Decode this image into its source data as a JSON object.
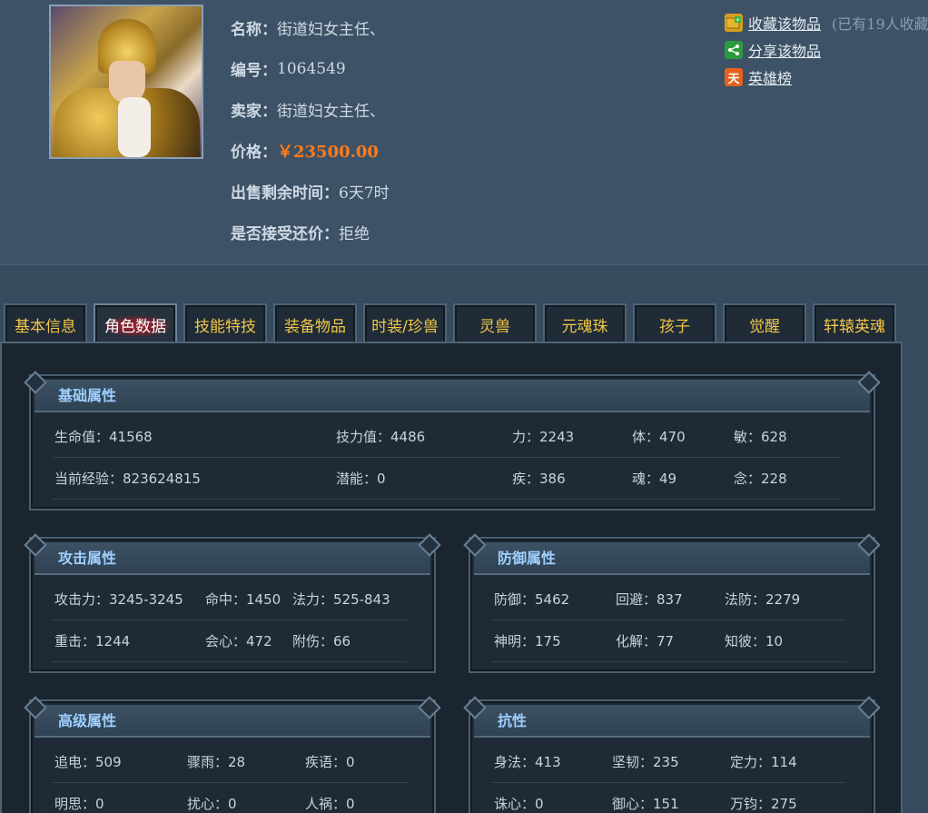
{
  "item": {
    "name_label": "名称：",
    "name": "街道妇女主任、",
    "id_label": "编号：",
    "id": "1064549",
    "seller_label": "卖家：",
    "seller": "街道妇女主任、",
    "price_label": "价格：",
    "price": "￥23500.00",
    "time_label": "出售剩余时间：",
    "time_left": "6天7时",
    "counter_label": "是否接受还价：",
    "counter_offer": "拒绝"
  },
  "actions": {
    "favorite": "收藏该物品",
    "favorite_count": "(已有19人收藏",
    "share": "分享该物品",
    "heroes": "英雄榜",
    "heroes_icon_glyph": "天"
  },
  "tabs": [
    {
      "label": "基本信息",
      "active": false
    },
    {
      "label": "角色数据",
      "active": true
    },
    {
      "label": "技能特技",
      "active": false
    },
    {
      "label": "装备物品",
      "active": false
    },
    {
      "label": "时装/珍兽",
      "active": false
    },
    {
      "label": "灵兽",
      "active": false
    },
    {
      "label": "元魂珠",
      "active": false
    },
    {
      "label": "孩子",
      "active": false
    },
    {
      "label": "觉醒",
      "active": false
    },
    {
      "label": "轩辕英魂",
      "active": false
    }
  ],
  "basic": {
    "title": "基础属性",
    "rows": [
      [
        "生命值：41568",
        "技力值：4486",
        "力：2243",
        "体：470",
        "敏：628"
      ],
      [
        "当前经验：823624815",
        "潜能：0",
        "疾：386",
        "魂：49",
        "念：228"
      ]
    ]
  },
  "attack": {
    "title": "攻击属性",
    "rows": [
      [
        "攻击力：3245-3245",
        "命中：1450",
        "法力：525-843"
      ],
      [
        "重击：1244",
        "会心：472",
        "附伤：66"
      ]
    ]
  },
  "defense": {
    "title": "防御属性",
    "rows": [
      [
        "防御：5462",
        "回避：837",
        "法防：2279"
      ],
      [
        "神明：175",
        "化解：77",
        "知彼：10"
      ]
    ]
  },
  "advanced": {
    "title": "高级属性",
    "rows": [
      [
        "追电：509",
        "骤雨：28",
        "疾语：0"
      ],
      [
        "明思：0",
        "扰心：0",
        "人祸：0"
      ]
    ]
  },
  "resist": {
    "title": "抗性",
    "rows": [
      [
        "身法：413",
        "坚韧：235",
        "定力：114"
      ],
      [
        "诛心：0",
        "御心：151",
        "万钧：275"
      ]
    ]
  },
  "colors": {
    "price": "#ff7a1a",
    "tab_text": "#f1c54a",
    "section_title": "#9fd0ff",
    "background": "#374a5e"
  }
}
